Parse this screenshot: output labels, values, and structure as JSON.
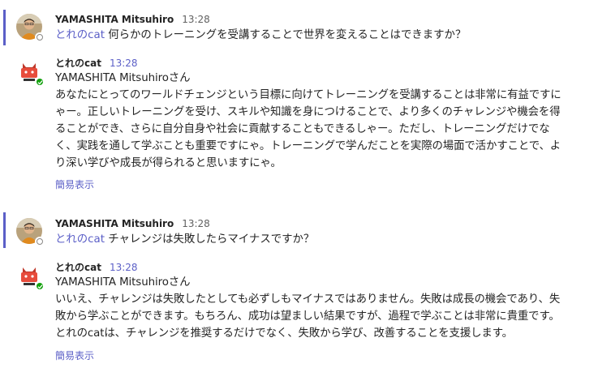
{
  "messages": [
    {
      "kind": "user",
      "sender": "YAMASHITA Mitsuhiro",
      "time": "13:28",
      "mention": "とれのcat",
      "text": " 何らかのトレーニングを受講することで世界を変えることはできますか？"
    },
    {
      "kind": "bot",
      "sender": "とれのcat",
      "time": "13:28",
      "greeting": "YAMASHITA Mitsuhiroさん",
      "lines": [
        "あなたにとってのワールドチェンジという目標に向けてトレーニングを受講することは非常に有益ですに",
        "ゃー。正しいトレーニングを受け、スキルや知識を身につけることで、より多くのチャレンジや機会を得",
        "ることができ、さらに自分自身や社会に貢献することもできるしゃー。ただし、トレーニングだけでな",
        "く、実践を通して学ぶことも重要ですにゃ。トレーニングで学んだことを実際の場面で活かすことで、よ",
        "り深い学びや成長が得られると思いますにゃ。"
      ],
      "link": "簡易表示"
    },
    {
      "kind": "user",
      "sender": "YAMASHITA Mitsuhiro",
      "time": "13:28",
      "mention": "とれのcat",
      "text": " チャレンジは失敗したらマイナスですか？"
    },
    {
      "kind": "bot",
      "sender": "とれのcat",
      "time": "13:28",
      "greeting": "YAMASHITA Mitsuhiroさん",
      "lines": [
        "いいえ、チャレンジは失敗したとしても必ずしもマイナスではありません。失敗は成長の機会であり、失",
        "敗から学ぶことができます。もちろん、成功は望ましい結果ですが、過程で学ぶことは非常に貴重です。",
        "とれのcatは、チャレンジを推奨するだけでなく、失敗から学び、改善することを支援します。"
      ],
      "link": "簡易表示"
    }
  ],
  "colors": {
    "accent": "#5b5fc7",
    "text": "#242424",
    "timestamp": "#616161",
    "online": "#13a10e"
  }
}
